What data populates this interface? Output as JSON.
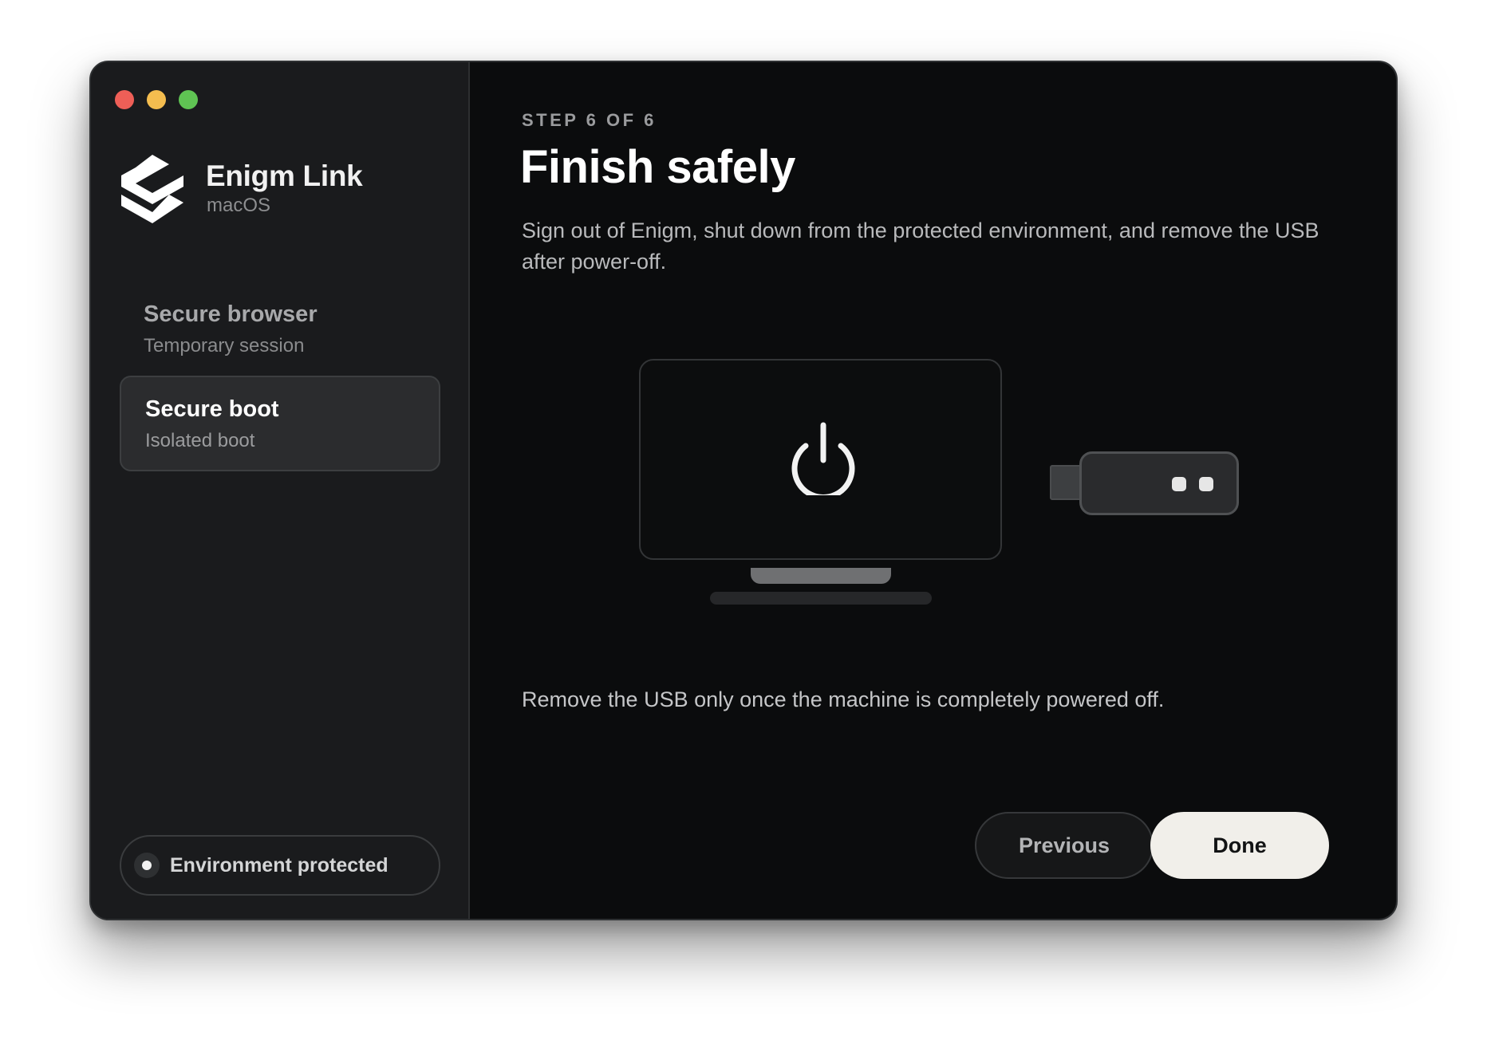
{
  "window": {
    "controls": [
      "close",
      "minimize",
      "zoom"
    ]
  },
  "brand": {
    "name": "Enigm Link",
    "platform": "macOS",
    "logo_icon": "enigm-logo-icon"
  },
  "sidebar": {
    "items": [
      {
        "title": "Secure browser",
        "subtitle": "Temporary session",
        "active": false
      },
      {
        "title": "Secure boot",
        "subtitle": "Isolated boot",
        "active": true
      }
    ],
    "status": {
      "label": "Environment protected",
      "icon": "status-dot-icon"
    }
  },
  "main": {
    "step_label": "STEP 6 OF 6",
    "title": "Finish safely",
    "description": "Sign out of Enigm, shut down from the protected environment, and remove the USB after power-off.",
    "illustration": {
      "icons": [
        "monitor-icon",
        "power-icon",
        "usb-drive-icon"
      ]
    },
    "note": "Remove the USB only once the machine is completely powered off.",
    "buttons": {
      "previous": "Previous",
      "done": "Done"
    }
  },
  "colors": {
    "window_bg": "#0b0c0d",
    "sidebar_bg": "#1a1b1d",
    "active_item_bg": "#2b2c2e",
    "done_button_bg": "#f1efea",
    "traffic_red": "#ee5f57",
    "traffic_yellow": "#f4bd4f",
    "traffic_green": "#5fc453"
  }
}
